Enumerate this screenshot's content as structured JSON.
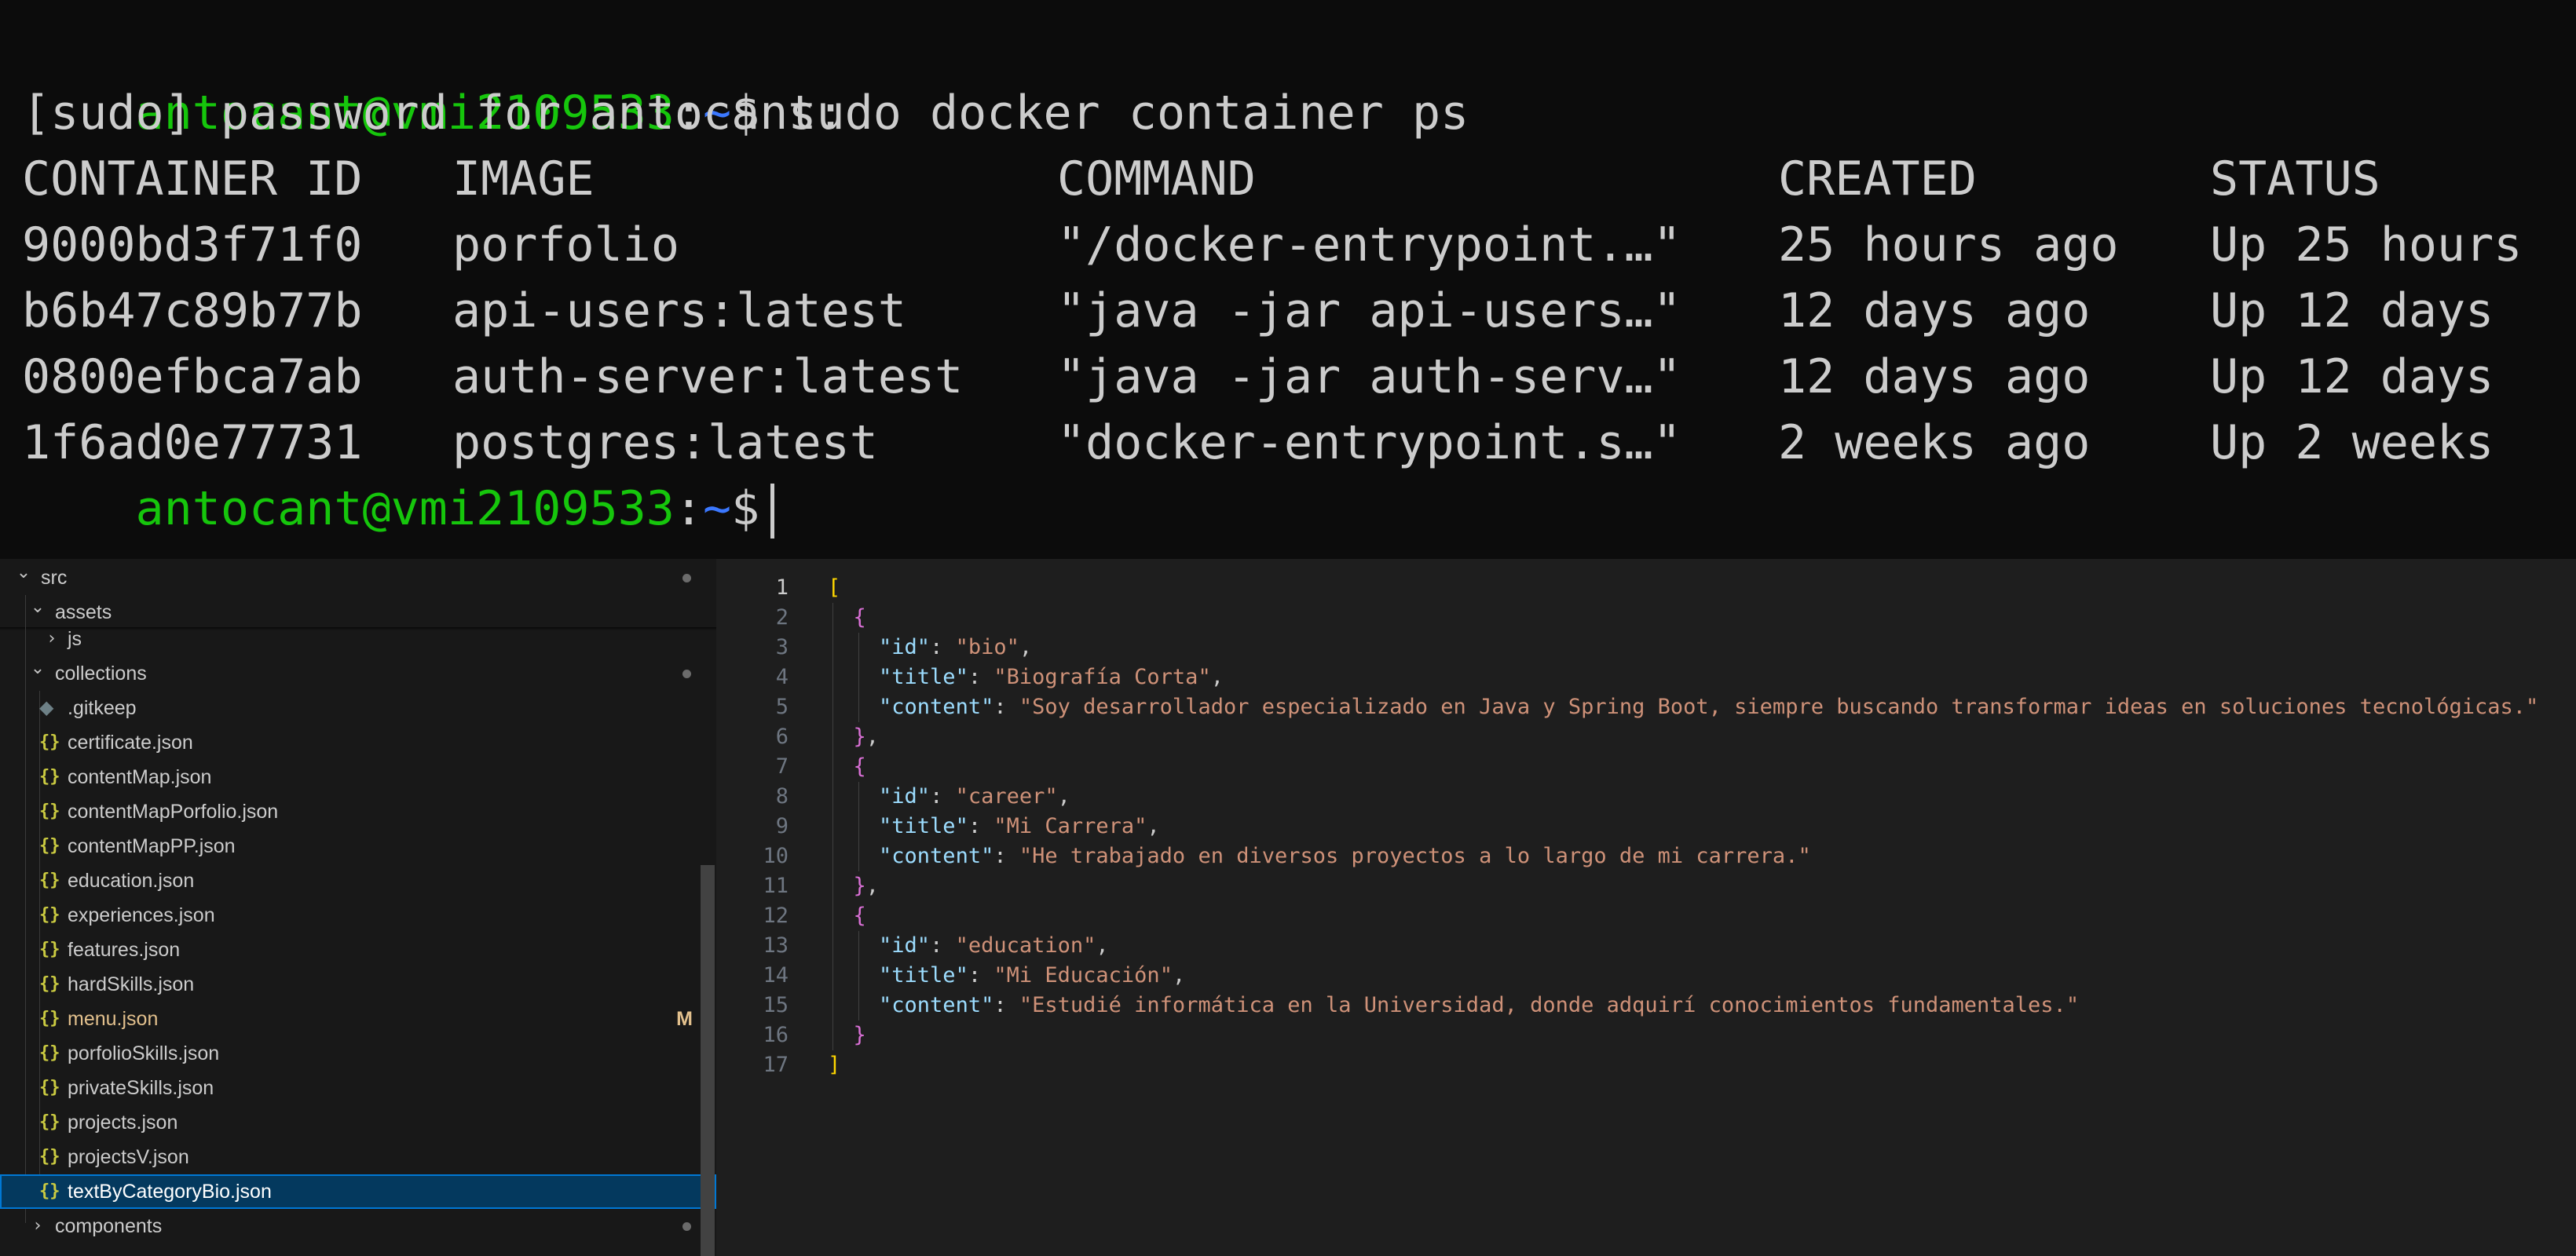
{
  "terminal": {
    "partial_text": "     ",
    "prompt": {
      "user_host": "antocant@vmi2109533",
      "colon": ":",
      "path": "~",
      "dollar": "$"
    },
    "command": " sudo docker container ps",
    "sudo_prompt": "[sudo] password for antocant:",
    "headers": [
      "CONTAINER ID",
      "IMAGE",
      "COMMAND",
      "CREATED",
      "STATUS"
    ],
    "rows": [
      [
        "9000bd3f71f0",
        "porfolio",
        "\"/docker-entrypoint.…\"",
        "25 hours ago",
        "Up 25 hours"
      ],
      [
        "b6b47c89b77b",
        "api-users:latest",
        "\"java -jar api-users…\"",
        "12 days ago",
        "Up 12 days"
      ],
      [
        "0800efbca7ab",
        "auth-server:latest",
        "\"java -jar auth-serv…\"",
        "12 days ago",
        "Up 12 days"
      ],
      [
        "1f6ad0e77731",
        "postgres:latest",
        "\"docker-entrypoint.s…\"",
        "2 weeks ago",
        "Up 2 weeks"
      ]
    ]
  },
  "explorer": {
    "src": "src",
    "assets": "assets",
    "js": "js",
    "collections": "collections",
    "files": [
      {
        "name": ".gitkeep",
        "type": "plain"
      },
      {
        "name": "certificate.json",
        "type": "json"
      },
      {
        "name": "contentMap.json",
        "type": "json"
      },
      {
        "name": "contentMapPorfolio.json",
        "type": "json"
      },
      {
        "name": "contentMapPP.json",
        "type": "json"
      },
      {
        "name": "education.json",
        "type": "json"
      },
      {
        "name": "experiences.json",
        "type": "json"
      },
      {
        "name": "features.json",
        "type": "json"
      },
      {
        "name": "hardSkills.json",
        "type": "json"
      },
      {
        "name": "menu.json",
        "type": "json",
        "status": "M"
      },
      {
        "name": "porfolioSkills.json",
        "type": "json"
      },
      {
        "name": "privateSkills.json",
        "type": "json"
      },
      {
        "name": "projects.json",
        "type": "json"
      },
      {
        "name": "projectsV.json",
        "type": "json"
      },
      {
        "name": "textByCategoryBio.json",
        "type": "json",
        "selected": true
      }
    ],
    "components": "components",
    "json_icon_glyph": "{}",
    "file_icon_glyph": "◆",
    "chevron_down": "⌄",
    "chevron_right": "›",
    "modified_color": "#e2c08d"
  },
  "editor": {
    "language": "json",
    "line_numbers": [
      "1",
      "2",
      "3",
      "4",
      "5",
      "6",
      "7",
      "8",
      "9",
      "10",
      "11",
      "12",
      "13",
      "14",
      "15",
      "16",
      "17"
    ],
    "entries": [
      {
        "id": "bio",
        "title": "Biografía Corta",
        "content": "Soy desarrollador especializado en Java y Spring Boot, siempre buscando transformar ideas en soluciones tecnológicas."
      },
      {
        "id": "career",
        "title": "Mi Carrera",
        "content": "He trabajado en diversos proyectos a lo largo de mi carrera."
      },
      {
        "id": "education",
        "title": "Mi Educación",
        "content": "Estudié informática en la Universidad, donde adquirí conocimientos fundamentales."
      }
    ],
    "keys": {
      "id": "\"id\"",
      "title": "\"title\"",
      "content": "\"content\""
    }
  },
  "colors": {
    "terminal_bg": "#0c0c0c",
    "prompt_green": "#16c60c",
    "prompt_blue": "#3b78ff",
    "editor_bg": "#1e1e1e",
    "explorer_bg": "#181818",
    "selection": "#04395e",
    "json_key": "#9cdcfe",
    "json_string": "#ce9178",
    "bracket_gold": "#ffd700",
    "bracket_pink": "#da70d6"
  }
}
